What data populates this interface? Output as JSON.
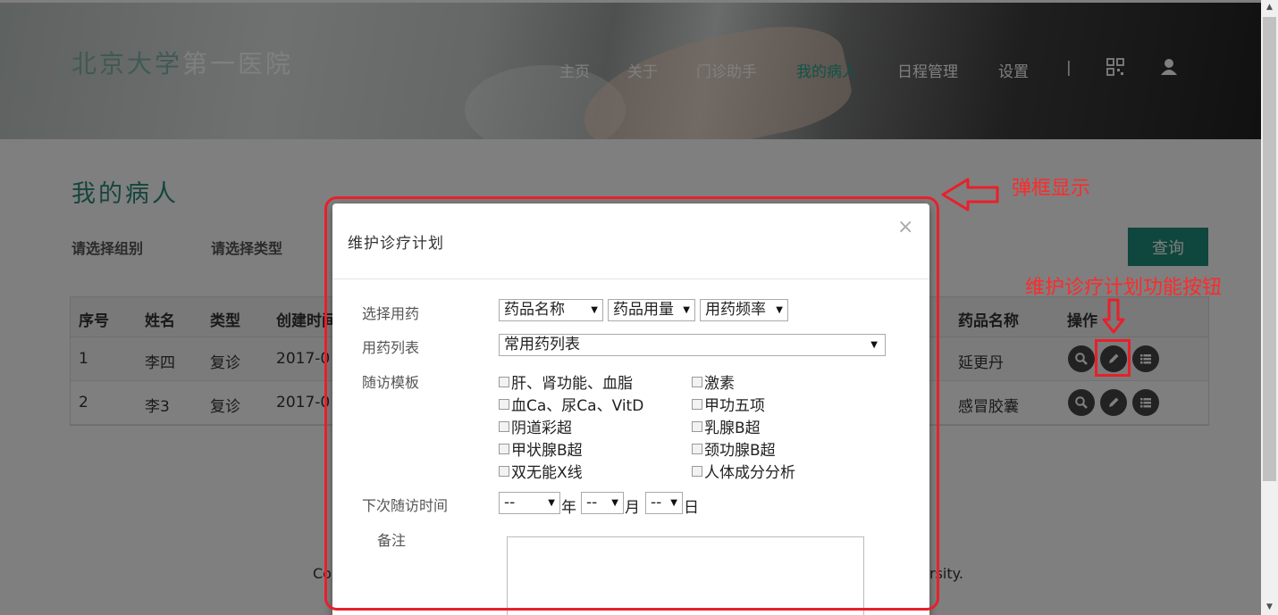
{
  "header": {
    "logo_accent": "北京大学",
    "logo_rest": "第一医院",
    "nav": [
      "主页",
      "关于",
      "门诊助手",
      "我的病人",
      "日程管理",
      "设置",
      "|"
    ],
    "nav_active": "我的病人",
    "icons": [
      "qrcode-icon",
      "user-icon"
    ]
  },
  "main": {
    "title": "我的病人",
    "filters": [
      "请选择组别",
      "请选择类型"
    ],
    "query_button": "查询",
    "table": {
      "headers": [
        "序号",
        "姓名",
        "类型",
        "创建时间",
        "药品名称",
        "操作"
      ],
      "rows": [
        {
          "index": "1",
          "name": "李四",
          "type": "复诊",
          "created": "2017-0",
          "drug": "延更丹"
        },
        {
          "index": "2",
          "name": "李3",
          "type": "复诊",
          "created": "2017-0",
          "drug": "感冒胶囊"
        }
      ],
      "actions": [
        "search-icon",
        "edit-icon",
        "list-icon"
      ]
    },
    "footer_left": "Co",
    "footer_right": "rsity."
  },
  "modal": {
    "title": "维护诊疗计划",
    "close": "×",
    "fields": {
      "drug_select_label": "选择用药",
      "drug_name": "药品名称",
      "drug_dose": "药品用量",
      "drug_freq": "用药频率",
      "drug_list_label": "用药列表",
      "drug_list_value": "常用药列表",
      "template_label": "随访模板",
      "templates_left": [
        "肝、肾功能、血脂",
        "血Ca、尿Ca、VitD",
        "阴道彩超",
        "甲状腺B超",
        "双无能X线"
      ],
      "templates_right": [
        "激素",
        "甲功五项",
        "乳腺B超",
        "颈功腺B超",
        "人体成分分析"
      ],
      "next_visit_label": "下次随访时间",
      "year_value": "--",
      "year_unit": "年",
      "month_value": "--",
      "month_unit": "月",
      "day_value": "--",
      "day_unit": "日",
      "remark_label": "备注"
    }
  },
  "annotations": {
    "popup_label": "弹框显示",
    "button_label": "维护诊疗计划功能按钮",
    "color": "#ff2a2a"
  },
  "colors": {
    "accent": "#1f8d7a",
    "nav_active": "#22a58e"
  }
}
